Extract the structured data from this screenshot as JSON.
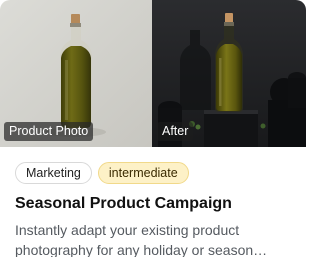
{
  "card": {
    "before_label": "Product Photo",
    "after_label": "After",
    "tags": {
      "category": "Marketing",
      "level": "intermediate"
    },
    "title": "Seasonal Product Campaign",
    "description": "Instantly adapt your existing product photography for any holiday or season…"
  },
  "colors": {
    "level_badge_bg": "#fdf1c7",
    "level_badge_border": "#f1d98a",
    "bottle_liquid": "#5b5a12",
    "after_background": "#1f2022"
  }
}
